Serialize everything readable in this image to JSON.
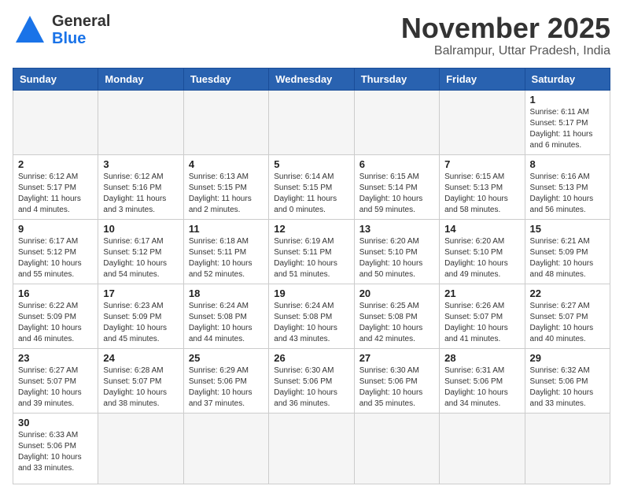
{
  "header": {
    "logo_general": "General",
    "logo_blue": "Blue",
    "month": "November 2025",
    "location": "Balrampur, Uttar Pradesh, India"
  },
  "weekdays": [
    "Sunday",
    "Monday",
    "Tuesday",
    "Wednesday",
    "Thursday",
    "Friday",
    "Saturday"
  ],
  "weeks": [
    [
      {
        "day": "",
        "sunrise": "",
        "sunset": "",
        "daylight": ""
      },
      {
        "day": "",
        "sunrise": "",
        "sunset": "",
        "daylight": ""
      },
      {
        "day": "",
        "sunrise": "",
        "sunset": "",
        "daylight": ""
      },
      {
        "day": "",
        "sunrise": "",
        "sunset": "",
        "daylight": ""
      },
      {
        "day": "",
        "sunrise": "",
        "sunset": "",
        "daylight": ""
      },
      {
        "day": "",
        "sunrise": "",
        "sunset": "",
        "daylight": ""
      },
      {
        "day": "1",
        "sunrise": "Sunrise: 6:11 AM",
        "sunset": "Sunset: 5:17 PM",
        "daylight": "Daylight: 11 hours and 6 minutes."
      }
    ],
    [
      {
        "day": "2",
        "sunrise": "Sunrise: 6:12 AM",
        "sunset": "Sunset: 5:17 PM",
        "daylight": "Daylight: 11 hours and 4 minutes."
      },
      {
        "day": "3",
        "sunrise": "Sunrise: 6:12 AM",
        "sunset": "Sunset: 5:16 PM",
        "daylight": "Daylight: 11 hours and 3 minutes."
      },
      {
        "day": "4",
        "sunrise": "Sunrise: 6:13 AM",
        "sunset": "Sunset: 5:15 PM",
        "daylight": "Daylight: 11 hours and 2 minutes."
      },
      {
        "day": "5",
        "sunrise": "Sunrise: 6:14 AM",
        "sunset": "Sunset: 5:15 PM",
        "daylight": "Daylight: 11 hours and 0 minutes."
      },
      {
        "day": "6",
        "sunrise": "Sunrise: 6:15 AM",
        "sunset": "Sunset: 5:14 PM",
        "daylight": "Daylight: 10 hours and 59 minutes."
      },
      {
        "day": "7",
        "sunrise": "Sunrise: 6:15 AM",
        "sunset": "Sunset: 5:13 PM",
        "daylight": "Daylight: 10 hours and 58 minutes."
      },
      {
        "day": "8",
        "sunrise": "Sunrise: 6:16 AM",
        "sunset": "Sunset: 5:13 PM",
        "daylight": "Daylight: 10 hours and 56 minutes."
      }
    ],
    [
      {
        "day": "9",
        "sunrise": "Sunrise: 6:17 AM",
        "sunset": "Sunset: 5:12 PM",
        "daylight": "Daylight: 10 hours and 55 minutes."
      },
      {
        "day": "10",
        "sunrise": "Sunrise: 6:17 AM",
        "sunset": "Sunset: 5:12 PM",
        "daylight": "Daylight: 10 hours and 54 minutes."
      },
      {
        "day": "11",
        "sunrise": "Sunrise: 6:18 AM",
        "sunset": "Sunset: 5:11 PM",
        "daylight": "Daylight: 10 hours and 52 minutes."
      },
      {
        "day": "12",
        "sunrise": "Sunrise: 6:19 AM",
        "sunset": "Sunset: 5:11 PM",
        "daylight": "Daylight: 10 hours and 51 minutes."
      },
      {
        "day": "13",
        "sunrise": "Sunrise: 6:20 AM",
        "sunset": "Sunset: 5:10 PM",
        "daylight": "Daylight: 10 hours and 50 minutes."
      },
      {
        "day": "14",
        "sunrise": "Sunrise: 6:20 AM",
        "sunset": "Sunset: 5:10 PM",
        "daylight": "Daylight: 10 hours and 49 minutes."
      },
      {
        "day": "15",
        "sunrise": "Sunrise: 6:21 AM",
        "sunset": "Sunset: 5:09 PM",
        "daylight": "Daylight: 10 hours and 48 minutes."
      }
    ],
    [
      {
        "day": "16",
        "sunrise": "Sunrise: 6:22 AM",
        "sunset": "Sunset: 5:09 PM",
        "daylight": "Daylight: 10 hours and 46 minutes."
      },
      {
        "day": "17",
        "sunrise": "Sunrise: 6:23 AM",
        "sunset": "Sunset: 5:09 PM",
        "daylight": "Daylight: 10 hours and 45 minutes."
      },
      {
        "day": "18",
        "sunrise": "Sunrise: 6:24 AM",
        "sunset": "Sunset: 5:08 PM",
        "daylight": "Daylight: 10 hours and 44 minutes."
      },
      {
        "day": "19",
        "sunrise": "Sunrise: 6:24 AM",
        "sunset": "Sunset: 5:08 PM",
        "daylight": "Daylight: 10 hours and 43 minutes."
      },
      {
        "day": "20",
        "sunrise": "Sunrise: 6:25 AM",
        "sunset": "Sunset: 5:08 PM",
        "daylight": "Daylight: 10 hours and 42 minutes."
      },
      {
        "day": "21",
        "sunrise": "Sunrise: 6:26 AM",
        "sunset": "Sunset: 5:07 PM",
        "daylight": "Daylight: 10 hours and 41 minutes."
      },
      {
        "day": "22",
        "sunrise": "Sunrise: 6:27 AM",
        "sunset": "Sunset: 5:07 PM",
        "daylight": "Daylight: 10 hours and 40 minutes."
      }
    ],
    [
      {
        "day": "23",
        "sunrise": "Sunrise: 6:27 AM",
        "sunset": "Sunset: 5:07 PM",
        "daylight": "Daylight: 10 hours and 39 minutes."
      },
      {
        "day": "24",
        "sunrise": "Sunrise: 6:28 AM",
        "sunset": "Sunset: 5:07 PM",
        "daylight": "Daylight: 10 hours and 38 minutes."
      },
      {
        "day": "25",
        "sunrise": "Sunrise: 6:29 AM",
        "sunset": "Sunset: 5:06 PM",
        "daylight": "Daylight: 10 hours and 37 minutes."
      },
      {
        "day": "26",
        "sunrise": "Sunrise: 6:30 AM",
        "sunset": "Sunset: 5:06 PM",
        "daylight": "Daylight: 10 hours and 36 minutes."
      },
      {
        "day": "27",
        "sunrise": "Sunrise: 6:30 AM",
        "sunset": "Sunset: 5:06 PM",
        "daylight": "Daylight: 10 hours and 35 minutes."
      },
      {
        "day": "28",
        "sunrise": "Sunrise: 6:31 AM",
        "sunset": "Sunset: 5:06 PM",
        "daylight": "Daylight: 10 hours and 34 minutes."
      },
      {
        "day": "29",
        "sunrise": "Sunrise: 6:32 AM",
        "sunset": "Sunset: 5:06 PM",
        "daylight": "Daylight: 10 hours and 33 minutes."
      }
    ],
    [
      {
        "day": "30",
        "sunrise": "Sunrise: 6:33 AM",
        "sunset": "Sunset: 5:06 PM",
        "daylight": "Daylight: 10 hours and 33 minutes."
      },
      {
        "day": "",
        "sunrise": "",
        "sunset": "",
        "daylight": ""
      },
      {
        "day": "",
        "sunrise": "",
        "sunset": "",
        "daylight": ""
      },
      {
        "day": "",
        "sunrise": "",
        "sunset": "",
        "daylight": ""
      },
      {
        "day": "",
        "sunrise": "",
        "sunset": "",
        "daylight": ""
      },
      {
        "day": "",
        "sunrise": "",
        "sunset": "",
        "daylight": ""
      },
      {
        "day": "",
        "sunrise": "",
        "sunset": "",
        "daylight": ""
      }
    ]
  ]
}
